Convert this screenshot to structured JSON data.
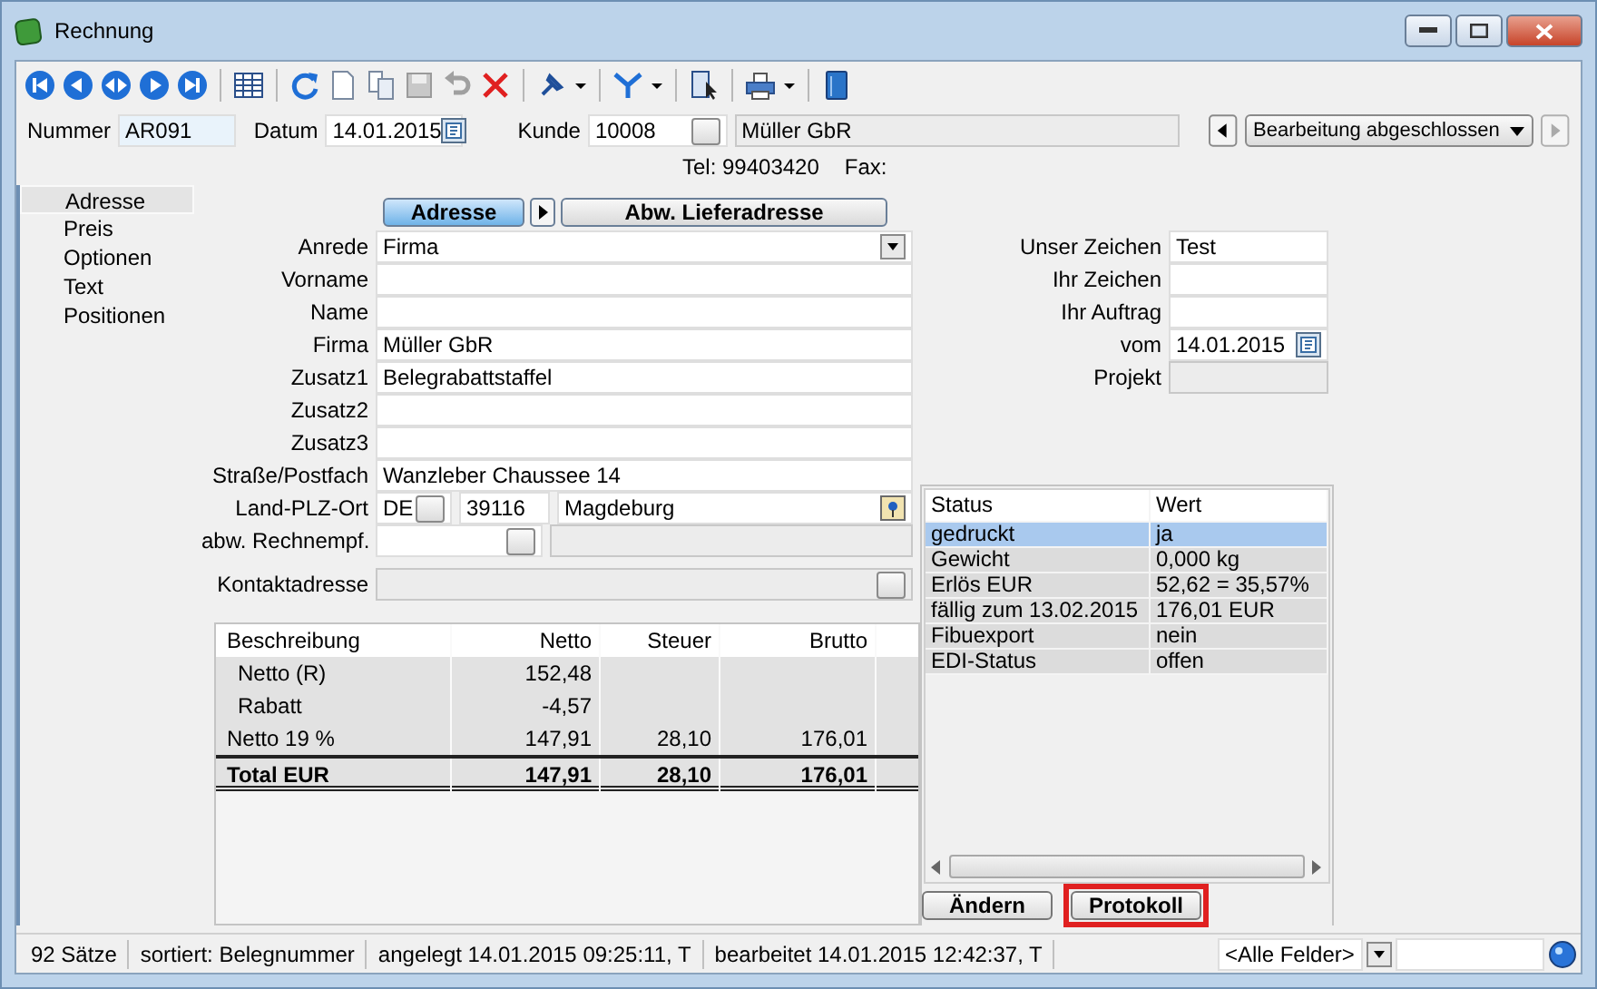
{
  "window": {
    "title": "Rechnung"
  },
  "header": {
    "number_label": "Nummer",
    "number": "AR091",
    "date_label": "Datum",
    "date": "14.01.2015",
    "customer_label": "Kunde",
    "customer_id": "10008",
    "customer_name": "Müller GbR",
    "status": "Bearbeitung abgeschlossen",
    "tel": "Tel: 99403420",
    "fax": "Fax:"
  },
  "sidebar": {
    "items": [
      {
        "label": "Adresse",
        "selected": true
      },
      {
        "label": "Preis",
        "selected": false
      },
      {
        "label": "Optionen",
        "selected": false
      },
      {
        "label": "Text",
        "selected": false
      },
      {
        "label": "Positionen",
        "selected": false
      }
    ]
  },
  "address_tabs": [
    {
      "label": "Adresse",
      "selected": true
    },
    {
      "label": "Abw. Lieferadresse",
      "selected": false
    }
  ],
  "address_fields": [
    {
      "kind": "dropdown",
      "label": "Anrede",
      "value": "Firma"
    },
    {
      "kind": "text",
      "label": "Vorname"
    },
    {
      "kind": "text",
      "label": "Name"
    },
    {
      "kind": "text",
      "label": "Firma",
      "value": "Müller GbR"
    },
    {
      "kind": "text",
      "label": "Zusatz1",
      "value": "Belegrabattstaffel"
    },
    {
      "kind": "text",
      "label": "Zusatz2"
    },
    {
      "kind": "text",
      "label": "Zusatz3"
    },
    {
      "kind": "text",
      "label": "Straße/Postfach",
      "value": "Wanzleber Chaussee 14"
    },
    {
      "kind": "location",
      "label": "Land-PLZ-Ort",
      "country": "DE",
      "zip": "39116",
      "city": "Magdeburg"
    },
    {
      "kind": "lookup",
      "label": "abw. Rechnempf."
    },
    {
      "kind": "readonly",
      "label": "Kontaktadresse"
    }
  ],
  "reference_fields": [
    {
      "kind": "text",
      "label": "Unser Zeichen",
      "value": "Test"
    },
    {
      "kind": "text",
      "label": "Ihr Zeichen"
    },
    {
      "kind": "text",
      "label": "Ihr Auftrag"
    },
    {
      "kind": "date",
      "label": "vom",
      "value": "14.01.2015"
    },
    {
      "kind": "readonly",
      "label": "Projekt"
    }
  ],
  "totals_table": {
    "columns": [
      "Beschreibung",
      "Netto",
      "Steuer",
      "Brutto"
    ],
    "rows": [
      {
        "kind": "sub",
        "cells": [
          "Netto (R)",
          "152,48",
          "",
          ""
        ]
      },
      {
        "kind": "sub",
        "cells": [
          "Rabatt",
          "-4,57",
          "",
          ""
        ]
      },
      {
        "kind": "normal",
        "cells": [
          "Netto 19 %",
          "147,91",
          "28,10",
          "176,01"
        ]
      },
      {
        "kind": "total",
        "cells": [
          "Total EUR",
          "147,91",
          "28,10",
          "176,01"
        ]
      }
    ]
  },
  "status_table": {
    "columns": [
      "Status",
      "Wert"
    ],
    "rows": [
      {
        "status": "gedruckt",
        "value": "ja",
        "selected": true
      },
      {
        "status": "Gewicht",
        "value": "0,000 kg",
        "selected": false
      },
      {
        "status": "Erlös EUR",
        "value": "52,62 = 35,57%",
        "selected": false
      },
      {
        "status": "fällig zum 13.02.2015",
        "value": "176,01 EUR",
        "selected": false
      },
      {
        "status": "Fibuexport",
        "value": "nein",
        "selected": false
      },
      {
        "status": "EDI-Status",
        "value": "offen",
        "selected": false
      }
    ]
  },
  "status_buttons": [
    {
      "label": "Ändern",
      "highlighted": false
    },
    {
      "label": "Protokoll",
      "highlighted": true
    }
  ],
  "status_bar": {
    "segments": [
      "92 Sätze",
      "sortiert: Belegnummer",
      "angelegt 14.01.2015 09:25:11, T",
      "bearbeitet 14.01.2015 12:42:37, T"
    ],
    "filter": "<Alle Felder>"
  }
}
